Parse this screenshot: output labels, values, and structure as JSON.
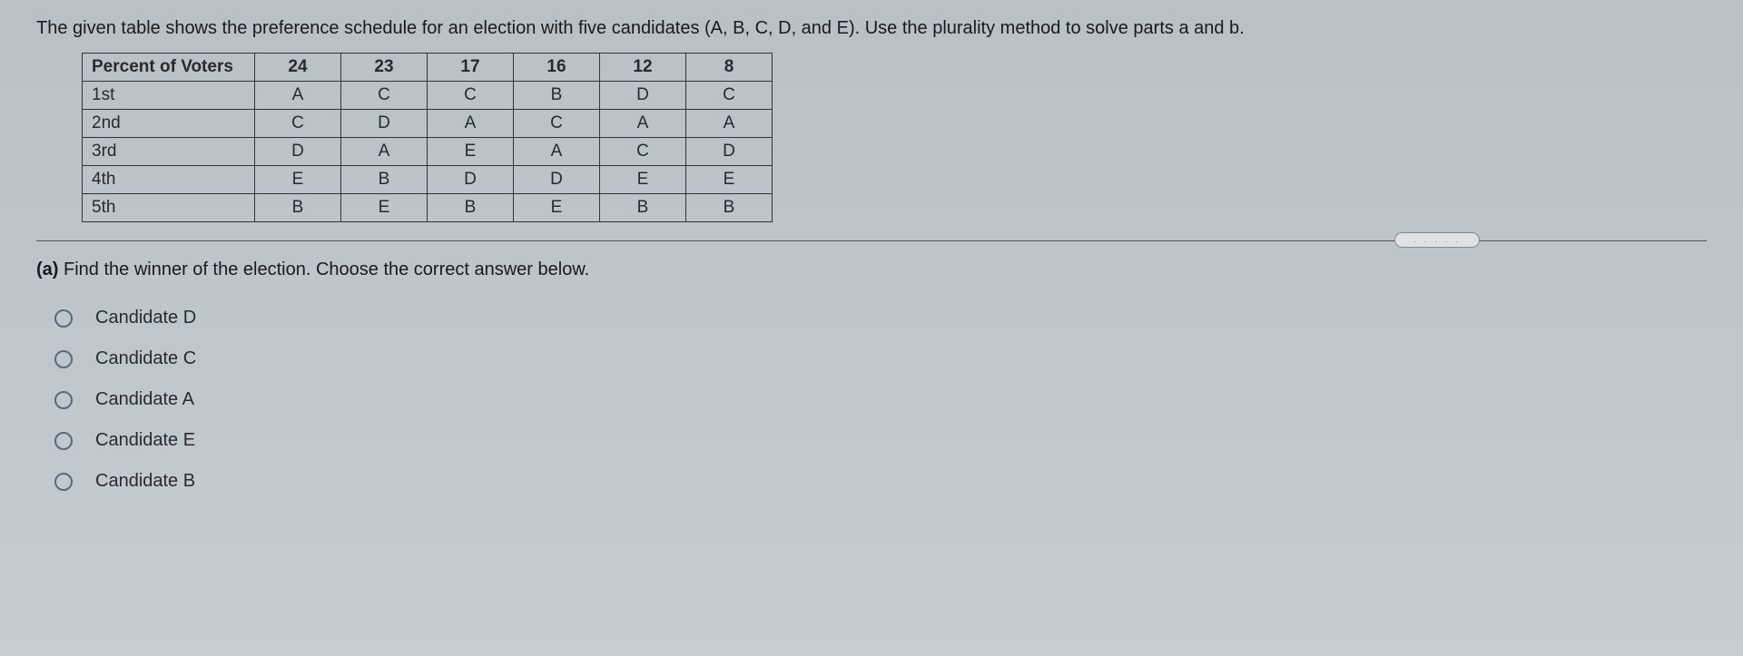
{
  "question": "The given table shows the preference schedule for an election with five candidates (A, B, C, D, and E). Use the plurality method to solve parts a and b.",
  "table": {
    "header_label": "Percent of Voters",
    "percents": [
      "24",
      "23",
      "17",
      "16",
      "12",
      "8"
    ],
    "rows": [
      {
        "label": "1st",
        "values": [
          "A",
          "C",
          "C",
          "B",
          "D",
          "C"
        ]
      },
      {
        "label": "2nd",
        "values": [
          "C",
          "D",
          "A",
          "C",
          "A",
          "A"
        ]
      },
      {
        "label": "3rd",
        "values": [
          "D",
          "A",
          "E",
          "A",
          "C",
          "D"
        ]
      },
      {
        "label": "4th",
        "values": [
          "E",
          "B",
          "D",
          "D",
          "E",
          "E"
        ]
      },
      {
        "label": "5th",
        "values": [
          "B",
          "E",
          "B",
          "E",
          "B",
          "B"
        ]
      }
    ]
  },
  "part_a": {
    "label": "(a)",
    "text": " Find the winner of the election. Choose the correct answer below."
  },
  "choices": [
    {
      "text": "Candidate D"
    },
    {
      "text": "Candidate C"
    },
    {
      "text": "Candidate A"
    },
    {
      "text": "Candidate E"
    },
    {
      "text": "Candidate B"
    }
  ],
  "pill_text": ". . . . ."
}
